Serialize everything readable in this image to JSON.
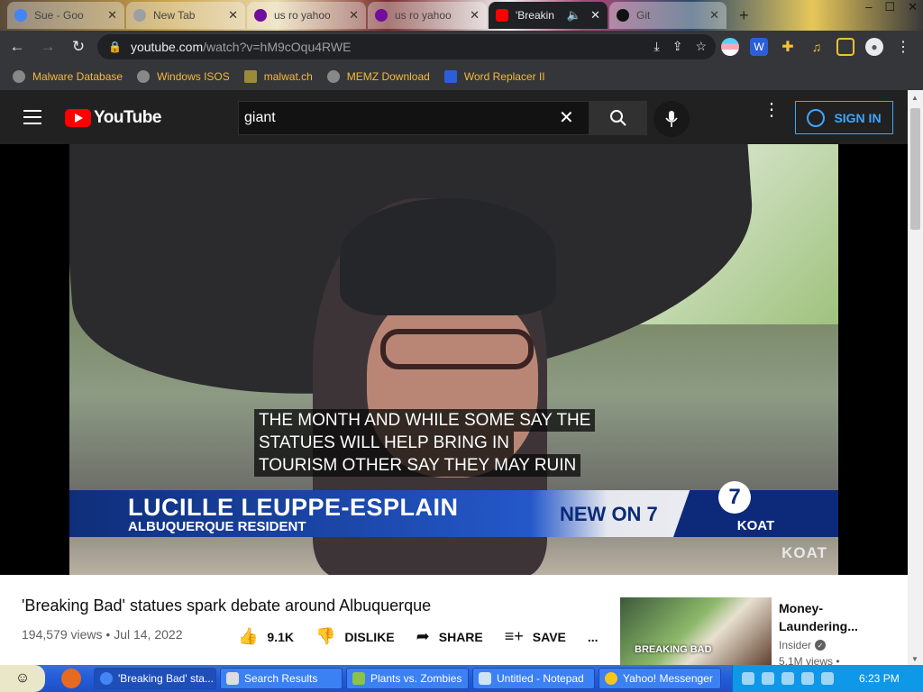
{
  "browser": {
    "tabs": [
      {
        "label": "Sue - Goo",
        "color": "#4285f4",
        "active": false
      },
      {
        "label": "New Tab",
        "color": "#9aa0a6",
        "active": false
      },
      {
        "label": "us ro yahoo",
        "color": "#720e9e",
        "active": false
      },
      {
        "label": "us ro yahoo",
        "color": "#720e9e",
        "active": false
      },
      {
        "label": "'Breakin",
        "color": "#ff0000",
        "active": true
      },
      {
        "label": "Git",
        "color": "#111111",
        "active": false
      }
    ],
    "new_tab": "+",
    "window_controls": {
      "minimize": "–",
      "maximize": "☐",
      "close": "✕"
    },
    "url_host": "youtube.com",
    "url_path": "/watch?v=hM9cOqu4RWE",
    "bookmarks": [
      {
        "label": "Malware Database"
      },
      {
        "label": "Windows ISOS"
      },
      {
        "label": "malwat.ch"
      },
      {
        "label": "MEMZ Download"
      },
      {
        "label": "Word Replacer II"
      }
    ]
  },
  "youtube": {
    "logo_text": "YouTube",
    "search_value": "giant",
    "sign_in_label": "SIGN IN",
    "video": {
      "caption_lines": [
        "THE MONTH AND WHILE SOME SAY THE",
        "STATUES WILL HELP BRING IN",
        "TOURISM OTHER SAY THEY MAY RUIN"
      ],
      "lower_third_name": "LUCILLE LEUPPE-ESPLAIN",
      "lower_third_role": "ALBUQUERQUE RESIDENT",
      "news_brand": "NEW ON 7",
      "station": "KOAT",
      "channel_number": "7",
      "watermark": "KOAT"
    },
    "title": "'Breaking Bad' statues spark debate around Albuquerque",
    "views": "194,579 views",
    "date": "Jul 14, 2022",
    "likes": "9.1K",
    "dislike_label": "DISLIKE",
    "share_label": "SHARE",
    "save_label": "SAVE",
    "more_label": "...",
    "recommendation": {
      "title": "Money-Laundering...",
      "thumb_label": "BREAKING BAD",
      "channel": "Insider",
      "views": "5.1M views •"
    }
  },
  "taskbar": {
    "tasks": [
      {
        "label": "'Breaking Bad' sta...",
        "active": true
      },
      {
        "label": "Search Results",
        "active": false
      },
      {
        "label": "Plants vs. Zombies",
        "active": false
      },
      {
        "label": "Untitled - Notepad",
        "active": false
      },
      {
        "label": "Yahoo! Messenger",
        "active": false
      }
    ],
    "clock": "6:23 PM"
  }
}
